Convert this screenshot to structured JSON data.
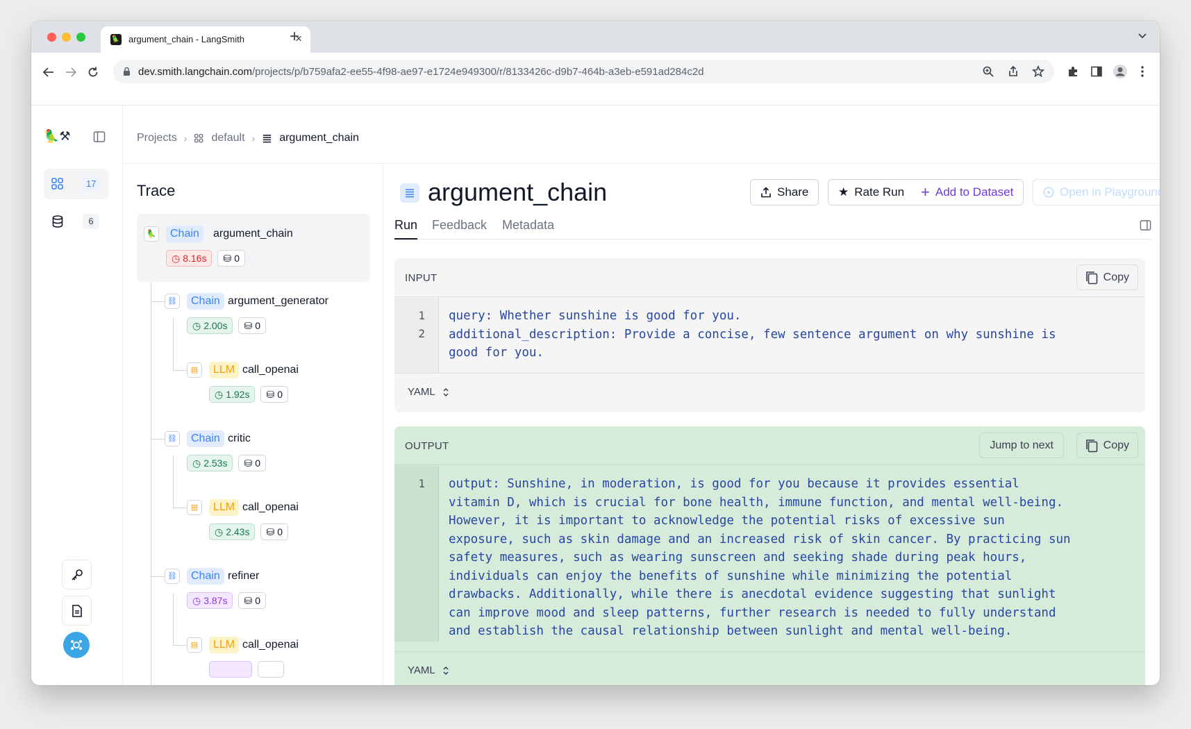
{
  "browser": {
    "tab_title": "argument_chain - LangSmith",
    "url_host": "dev.smith.langchain.com",
    "url_path": "/projects/p/b759afa2-ee55-4f98-ae97-e1724e949300/r/8133426c-d9b7-464b-a3eb-e591ad284c2d"
  },
  "nav": {
    "projects_count": "17",
    "datasets_count": "6"
  },
  "breadcrumb": {
    "projects": "Projects",
    "default": "default",
    "current": "argument_chain"
  },
  "trace": {
    "title": "Trace",
    "nodes": [
      {
        "type": "Chain",
        "name": "argument_chain",
        "latency": "8.16s",
        "tokens": "0"
      },
      {
        "type": "Chain",
        "name": "argument_generator",
        "latency": "2.00s",
        "tokens": "0"
      },
      {
        "type": "LLM",
        "name": "call_openai",
        "latency": "1.92s",
        "tokens": "0"
      },
      {
        "type": "Chain",
        "name": "critic",
        "latency": "2.53s",
        "tokens": "0"
      },
      {
        "type": "LLM",
        "name": "call_openai",
        "latency": "2.43s",
        "tokens": "0"
      },
      {
        "type": "Chain",
        "name": "refiner",
        "latency": "3.87s",
        "tokens": "0"
      },
      {
        "type": "LLM",
        "name": "call_openai"
      }
    ]
  },
  "run": {
    "title": "argument_chain",
    "share": "Share",
    "rate": "Rate Run",
    "add_dataset": "Add to Dataset",
    "playground": "Open in Playground",
    "tabs": [
      "Run",
      "Feedback",
      "Metadata"
    ]
  },
  "input": {
    "label": "INPUT",
    "copy": "Copy",
    "line_numbers": [
      "1",
      "2"
    ],
    "code": "query: Whether sunshine is good for you.\nadditional_description: Provide a concise, few sentence argument on why sunshine is\ngood for you.",
    "format": "YAML"
  },
  "output": {
    "label": "OUTPUT",
    "jump": "Jump to next",
    "copy": "Copy",
    "line_numbers": [
      "1"
    ],
    "code": "output: Sunshine, in moderation, is good for you because it provides essential\nvitamin D, which is crucial for bone health, immune function, and mental well-being.\nHowever, it is important to acknowledge the potential risks of excessive sun\nexposure, such as skin damage and an increased risk of skin cancer. By practicing sun\nsafety measures, such as wearing sunscreen and seeking shade during peak hours,\nindividuals can enjoy the benefits of sunshine while minimizing the potential\ndrawbacks. Additionally, while there is anecdotal evidence suggesting that sunlight\ncan improve mood and sleep patterns, further research is needed to fully understand\nand establish the causal relationship between sunlight and mental well-being.",
    "format": "YAML"
  }
}
